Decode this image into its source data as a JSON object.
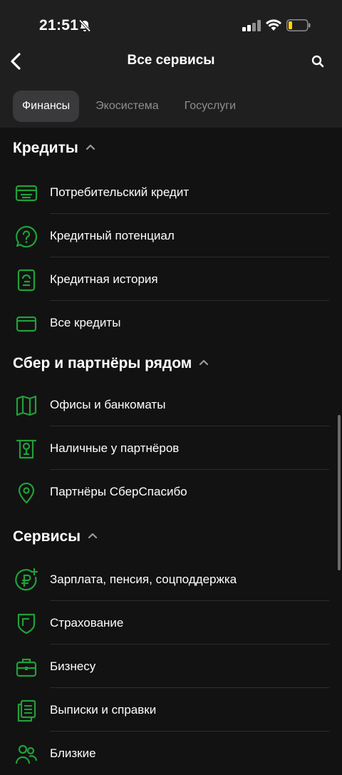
{
  "status_bar": {
    "time": "21:51",
    "icons": [
      "bell-muted-icon",
      "signal-icon",
      "wifi-icon",
      "battery-low-icon"
    ]
  },
  "header": {
    "title": "Все сервисы",
    "back_icon": "chevron-left-icon",
    "search_icon": "search-icon"
  },
  "tabs": [
    {
      "label": "Финансы",
      "active": true
    },
    {
      "label": "Экосистема",
      "active": false
    },
    {
      "label": "Госуслуги",
      "active": false
    }
  ],
  "colors": {
    "accent": "#21a038",
    "background": "#121212",
    "topbar": "#1f1f1f",
    "muted_text": "#8e8e93"
  },
  "sections": [
    {
      "title": "Кредиты",
      "items": [
        {
          "label": "Потребительский кредит",
          "icon": "card-icon"
        },
        {
          "label": "Кредитный потенциал",
          "icon": "question-bubble-icon"
        },
        {
          "label": "Кредитная история",
          "icon": "document-icon"
        },
        {
          "label": "Все кредиты",
          "icon": "wallet-icon"
        }
      ]
    },
    {
      "title": "Сбер и партнёры рядом",
      "items": [
        {
          "label": "Офисы и банкоматы",
          "icon": "map-icon"
        },
        {
          "label": "Наличные у партнёров",
          "icon": "atm-cash-icon"
        },
        {
          "label": "Партнёры СберСпасибо",
          "icon": "location-pin-icon"
        }
      ]
    },
    {
      "title": "Сервисы",
      "items": [
        {
          "label": "Зарплата, пенсия, соцподдержка",
          "icon": "ruble-plus-icon"
        },
        {
          "label": "Страхование",
          "icon": "shield-icon"
        },
        {
          "label": "Бизнесу",
          "icon": "briefcase-icon"
        },
        {
          "label": "Выписки и справки",
          "icon": "documents-icon"
        },
        {
          "label": "Близкие",
          "icon": "people-icon"
        }
      ]
    }
  ]
}
